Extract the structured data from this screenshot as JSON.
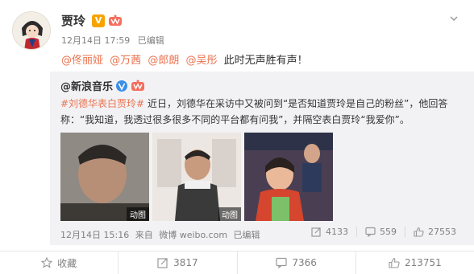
{
  "post": {
    "author": "贾玲",
    "badge": "V",
    "time": "12月14日 17:59",
    "edited": "已编辑",
    "mentions": [
      "@佟丽娅",
      "@万茜",
      "@郎朗",
      "@吴彤"
    ],
    "text": "此时无声胜有声！"
  },
  "repost": {
    "author": "@新浪音乐",
    "hashtag": "#刘德华表白贾玲#",
    "body_line1": " 近日，刘德华在采访中又被问到“是否知道贾玲是自己的粉丝”，他回答",
    "body_line2": "称：“我知道，我透过很多很多不同的平台都有问我”，并隔空表白贾玲“我爱你”。",
    "images": [
      {
        "tag": "动图"
      },
      {
        "tag": "动图"
      },
      {
        "tag": ""
      }
    ],
    "time": "12月14日 15:16",
    "source_prefix": "来自",
    "source": "微博 weibo.com",
    "edited": "已编辑",
    "stats": {
      "forward": "4133",
      "comment": "559",
      "like": "27553"
    }
  },
  "footer": {
    "favorite": "收藏",
    "forward": "3817",
    "comment": "7366",
    "like": "213751"
  }
}
